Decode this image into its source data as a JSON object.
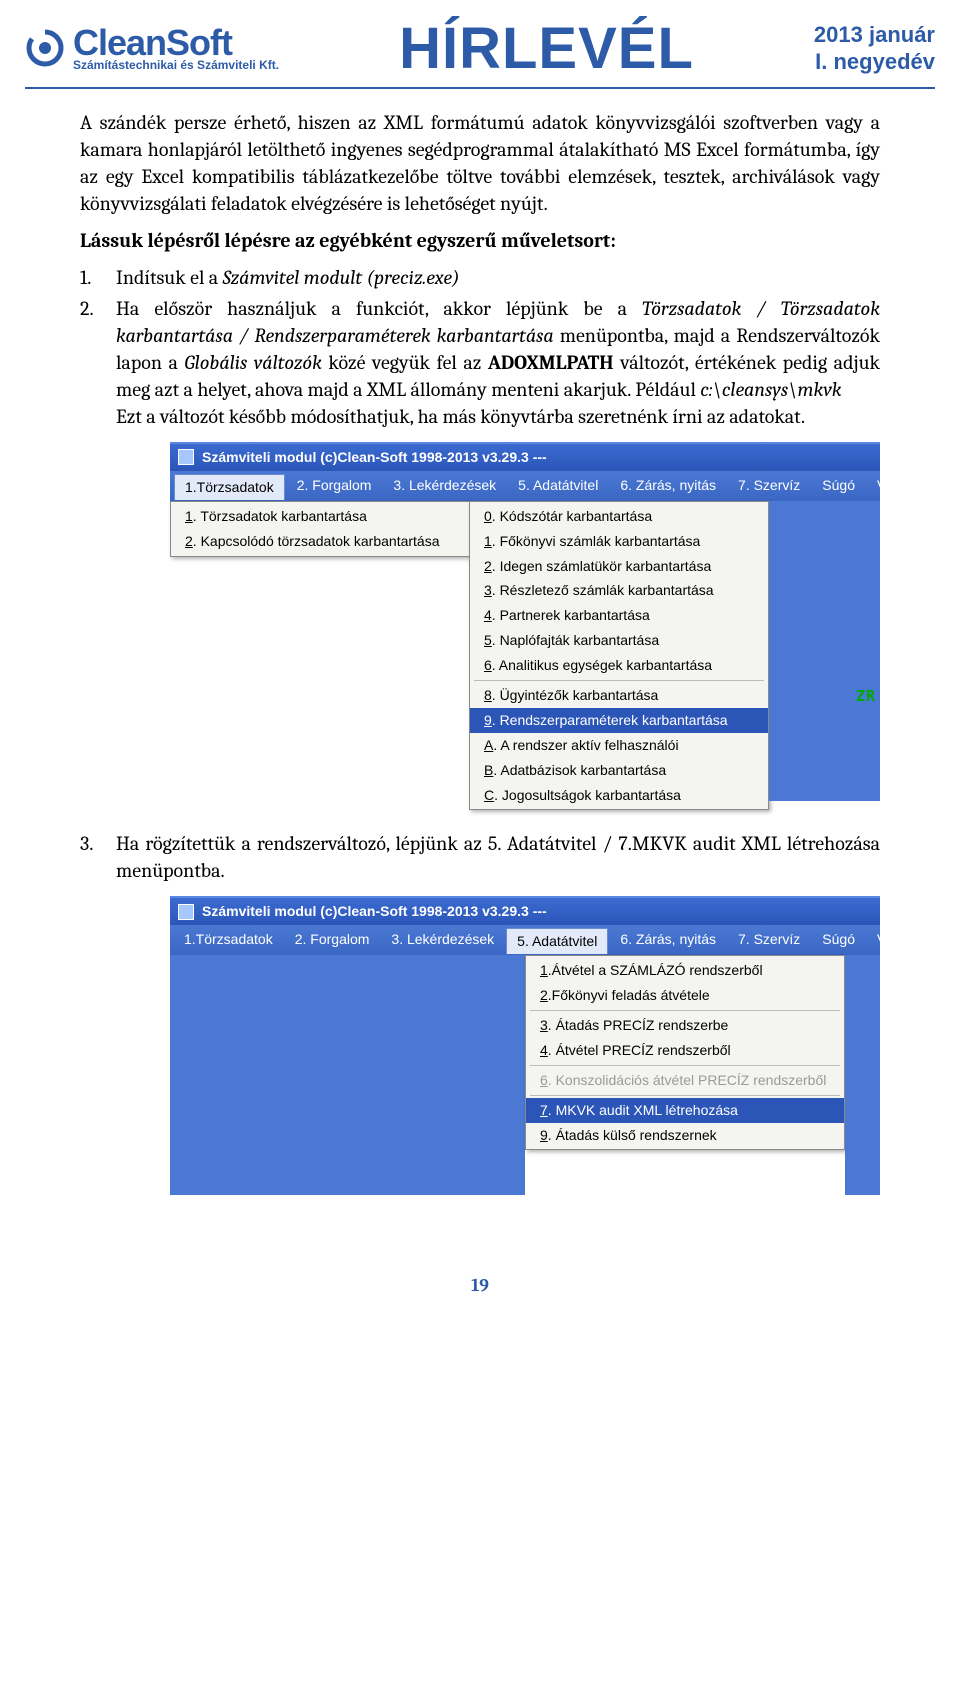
{
  "header": {
    "brand_name": "CleanSoft",
    "brand_sub": "Számítástechnikai és Számviteli Kft.",
    "banner": "HÍRLEVÉL",
    "date_line1": "2013 január",
    "date_line2": "I. negyedév"
  },
  "body": {
    "para1": "A szándék persze érhető, hiszen az XML formátumú adatok könyvvizsgálói szoftverben vagy a kamara honlapjáról letölthető ingyenes segédprogrammal átalakítható MS Excel formátumba, így az egy Excel kompatibilis táblázatkezelőbe töltve további elemzések, tesztek, archiválások vagy könyvvizsgálati feladatok elvégzésére is lehetőséget nyújt.",
    "subhead": "Lássuk lépésről lépésre az egyébként egyszerű műveletsort:",
    "step1_num": "1.",
    "step1_a": "Indítsuk el a ",
    "step1_b": "Számvitel modult (preciz.exe)",
    "step2_num": "2.",
    "step2_a": "Ha először használjuk a funkciót, akkor lépjünk be a ",
    "step2_b": "Törzsadatok / Törzsadatok karbantartása / Rendszerparaméterek karbantartása",
    "step2_c": " menüpontba, majd a Rendszerváltozók lapon a ",
    "step2_d": "Globális változók",
    "step2_e": " közé vegyük fel az ",
    "step2_f": "ADOXMLPATH",
    "step2_g": " változót, értékének pedig adjuk meg azt a helyet, ahova majd a XML állomány menteni akarjuk. Például ",
    "step2_h": "c:\\cleansys\\mkvk",
    "step2_i": "Ezt a változót később módosíthatjuk, ha más könyvtárba szeretnénk írni az adatokat.",
    "step3_num": "3.",
    "step3": "Ha rögzítettük a rendszerváltozó, lépjünk az 5. Adatátvitel / 7.MKVK audit XML létrehozása menüpontba."
  },
  "shot1": {
    "title": "Számviteli modul (c)Clean-Soft 1998-2013 v3.29.3  ---",
    "menu": [
      "1.Törzsadatok",
      "2. Forgalom",
      "3. Lekérdezések",
      "5. Adatátvitel",
      "6. Zárás, nyitás",
      "7. Szervíz",
      "Súgó",
      "Vége"
    ],
    "left": [
      {
        "u": "1",
        "t": ". Törzsadatok karbantartása"
      },
      {
        "u": "2",
        "t": ". Kapcsolódó törzsadatok karbantartása"
      }
    ],
    "right": [
      {
        "u": "0",
        "t": ". Kódszótár karbantartása"
      },
      {
        "u": "1",
        "t": ". Főkönyvi számlák karbantartása"
      },
      {
        "u": "2",
        "t": ". Idegen számlatükör karbantartása"
      },
      {
        "u": "3",
        "t": ". Részletező számlák karbantartása"
      },
      {
        "u": "4",
        "t": ". Partnerek karbantartása"
      },
      {
        "u": "5",
        "t": ". Naplófajták karbantartása"
      },
      {
        "u": "6",
        "t": ". Analitikus egységek karbantartása"
      },
      {
        "sep": true
      },
      {
        "u": "8",
        "t": ". Ügyintézők karbantartása"
      },
      {
        "u": "9",
        "t": ". Rendszerparaméterek karbantartása",
        "hl": true
      },
      {
        "u": "A",
        "t": ". A rendszer aktív felhasználói"
      },
      {
        "u": "B",
        "t": ". Adatbázisok karbantartása"
      },
      {
        "u": "C",
        "t": ". Jogosultságok karbantartása"
      }
    ],
    "zr": "ZR"
  },
  "shot2": {
    "title": "Számviteli modul (c)Clean-Soft 1998-2013 v3.29.3  ---",
    "menu": [
      "1.Törzsadatok",
      "2. Forgalom",
      "3. Lekérdezések",
      "5. Adatátvitel",
      "6. Zárás, nyitás",
      "7. Szervíz",
      "Súgó",
      "Vége"
    ],
    "items": [
      {
        "u": "1",
        "t": ".Átvétel a SZÁMLÁZÓ rendszerből"
      },
      {
        "u": "2",
        "t": ".Főkönyvi feladás átvétele"
      },
      {
        "sep": true
      },
      {
        "u": "3",
        "t": ". Átadás PRECÍZ rendszerbe"
      },
      {
        "u": "4",
        "t": ". Átvétel PRECÍZ rendszerből"
      },
      {
        "sep": true
      },
      {
        "u": "6",
        "t": ". Konszolidációs átvétel PRECÍZ rendszerből",
        "disabled": true
      },
      {
        "sep": true
      },
      {
        "u": "7",
        "t": ". MKVK audit XML létrehozása",
        "hl": true
      },
      {
        "u": "9",
        "t": ". Átadás külső rendszernek"
      }
    ]
  },
  "page_number": "19"
}
